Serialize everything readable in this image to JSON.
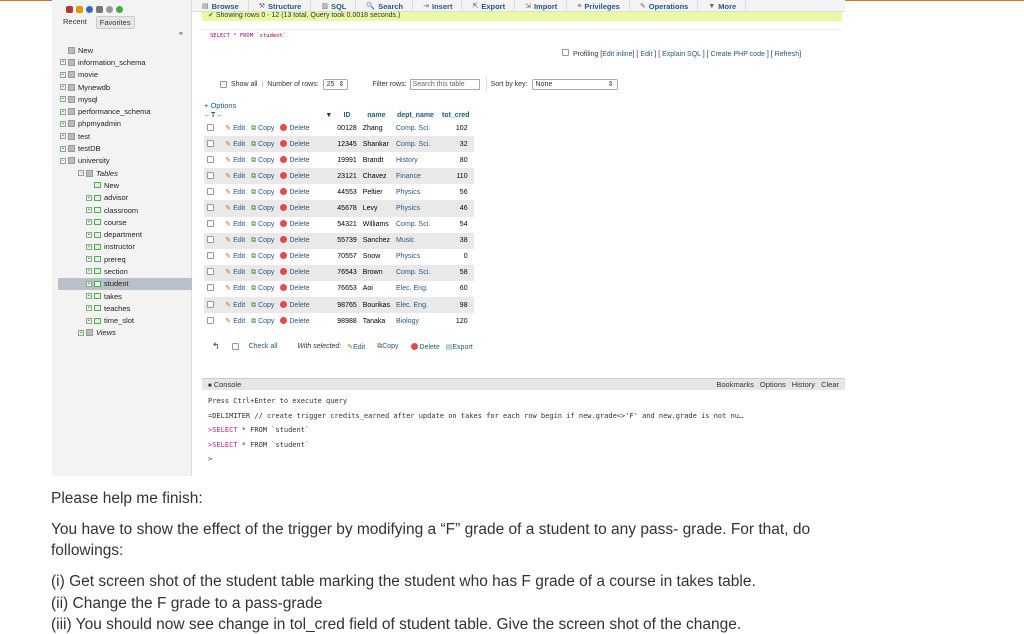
{
  "nav": {
    "tabs": [
      "Recent",
      "Favorites"
    ],
    "collapse_icon": "link-icon",
    "tree": [
      {
        "label": "New",
        "level": 1
      },
      {
        "label": "information_schema",
        "level": 1
      },
      {
        "label": "movie",
        "level": 1
      },
      {
        "label": "Mynewdb",
        "level": 1
      },
      {
        "label": "mysql",
        "level": 1
      },
      {
        "label": "performance_schema",
        "level": 1
      },
      {
        "label": "phpmyadmin",
        "level": 1
      },
      {
        "label": "test",
        "level": 1
      },
      {
        "label": "testDB",
        "level": 1
      },
      {
        "label": "university",
        "level": 1
      },
      {
        "label": "Tables",
        "level": 2
      },
      {
        "label": "New",
        "level": 3
      },
      {
        "label": "advisor",
        "level": 3
      },
      {
        "label": "classroom",
        "level": 3
      },
      {
        "label": "course",
        "level": 3
      },
      {
        "label": "department",
        "level": 3
      },
      {
        "label": "instructor",
        "level": 3
      },
      {
        "label": "prereq",
        "level": 3
      },
      {
        "label": "section",
        "level": 3
      },
      {
        "label": "student",
        "level": 3,
        "selected": true
      },
      {
        "label": "takes",
        "level": 3
      },
      {
        "label": "teaches",
        "level": 3
      },
      {
        "label": "time_slot",
        "level": 3
      },
      {
        "label": "Views",
        "level": 2
      }
    ]
  },
  "menu": [
    "Browse",
    "Structure",
    "SQL",
    "Search",
    "Insert",
    "Export",
    "Import",
    "Privileges",
    "Operations",
    "More"
  ],
  "notice": "Showing rows 0 - 12 (13 total, Query took 0.0018 seconds.)",
  "query": {
    "select": "SELECT",
    "star": "*",
    "from": "FROM",
    "table": "`student`"
  },
  "links": {
    "profiling": "Profiling",
    "edit_inline": "Edit inline",
    "edit": "Edit",
    "explain": "Explain SQL",
    "php": "Create PHP code",
    "refresh": "Refresh"
  },
  "controls": {
    "show_all": "Show all",
    "num_rows_label": "Number of rows:",
    "num_rows_value": "25",
    "filter_label": "Filter rows:",
    "filter_placeholder": "Search this table",
    "sort_label": "Sort by key:",
    "sort_value": "None"
  },
  "options_label": "+ Options",
  "table": {
    "columns": [
      "ID",
      "name",
      "dept_name",
      "tot_cred"
    ],
    "action_labels": {
      "edit": "Edit",
      "copy": "Copy",
      "delete": "Delete"
    },
    "rows": [
      {
        "id": "00128",
        "name": "Zhang",
        "dept": "Comp. Sci.",
        "cred": "102"
      },
      {
        "id": "12345",
        "name": "Shankar",
        "dept": "Comp. Sci.",
        "cred": "32"
      },
      {
        "id": "19991",
        "name": "Brandt",
        "dept": "History",
        "cred": "80"
      },
      {
        "id": "23121",
        "name": "Chavez",
        "dept": "Finance",
        "cred": "110"
      },
      {
        "id": "44553",
        "name": "Peltier",
        "dept": "Physics",
        "cred": "56"
      },
      {
        "id": "45678",
        "name": "Levy",
        "dept": "Physics",
        "cred": "46"
      },
      {
        "id": "54321",
        "name": "Williams",
        "dept": "Comp. Sci.",
        "cred": "54"
      },
      {
        "id": "55739",
        "name": "Sanchez",
        "dept": "Music",
        "cred": "38"
      },
      {
        "id": "70557",
        "name": "Snow",
        "dept": "Physics",
        "cred": "0"
      },
      {
        "id": "76543",
        "name": "Brown",
        "dept": "Comp. Sci.",
        "cred": "58"
      },
      {
        "id": "76653",
        "name": "Aoi",
        "dept": "Elec. Eng.",
        "cred": "60"
      },
      {
        "id": "98765",
        "name": "Bourikas",
        "dept": "Elec. Eng.",
        "cred": "98"
      },
      {
        "id": "98988",
        "name": "Tanaka",
        "dept": "Biology",
        "cred": "120"
      }
    ]
  },
  "bottom": {
    "check_all": "Check all",
    "with_selected": "With selected:",
    "edit": "Edit",
    "copy": "Copy",
    "delete": "Delete",
    "export": "Export"
  },
  "console": {
    "title": "Console",
    "buttons": [
      "Bookmarks",
      "Options",
      "History",
      "Clear"
    ],
    "hint": "Press Ctrl+Enter to execute query",
    "line1": "=DELIMITER // create trigger credits_earned after update on takes for each row begin if new.grade<>'F' and new.grade is not nu…",
    "line2_kw": ">SELECT",
    "line2_rest": " * FROM `student`",
    "line3_kw": ">SELECT",
    "line3_rest": " * FROM `student`",
    "prompt": ">"
  },
  "question": {
    "intro": "Please help me finish:",
    "body": "You have to show the effect of the trigger by modifying a “F” grade of a student to any pass- grade. For that, do followings:",
    "items": [
      "(i) Get screen shot of the student table marking the student who has F grade of a course in takes table.",
      "(ii) Change the F grade to a pass-grade",
      "(iii) You should now see change in tol_cred field of student table. Give the screen shot of the change."
    ]
  }
}
